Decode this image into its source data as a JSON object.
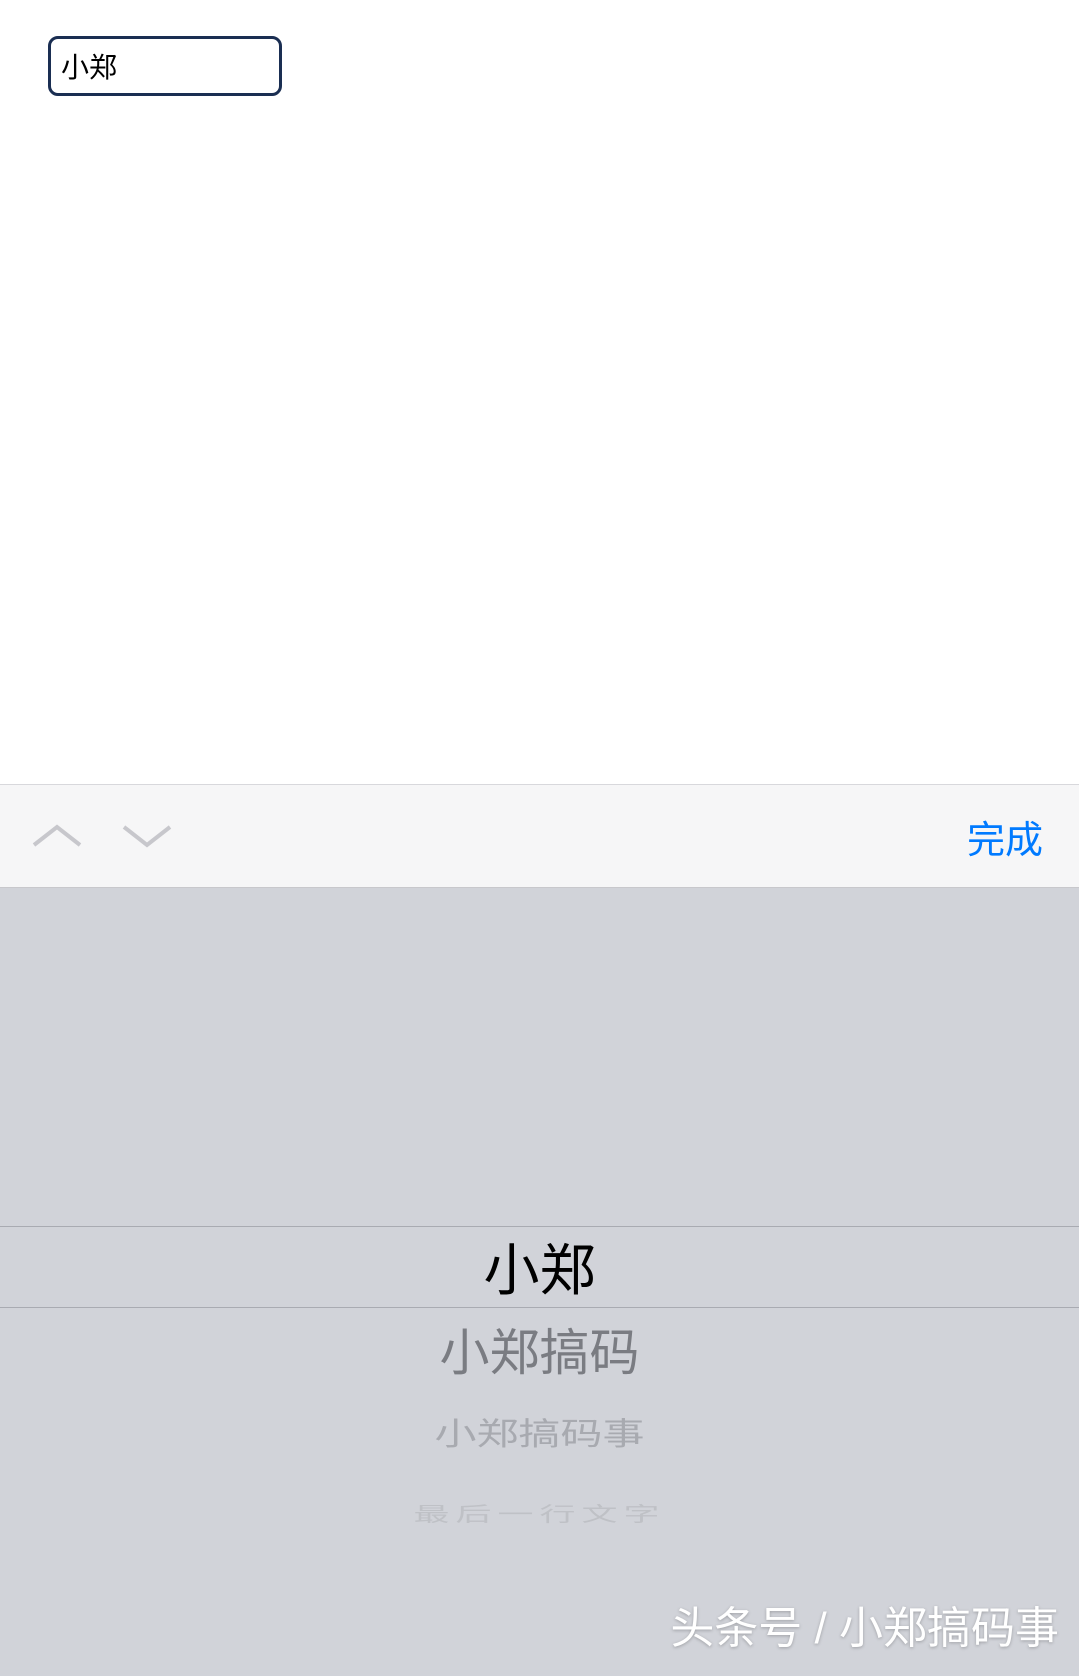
{
  "input": {
    "value": "小郑"
  },
  "accessory": {
    "done_label": "完成"
  },
  "picker": {
    "selected": "小郑",
    "below_1": "小郑搞码",
    "below_2": "小郑搞码事",
    "below_3": "最后一行文字"
  },
  "watermark": "头条号 / 小郑搞码事"
}
